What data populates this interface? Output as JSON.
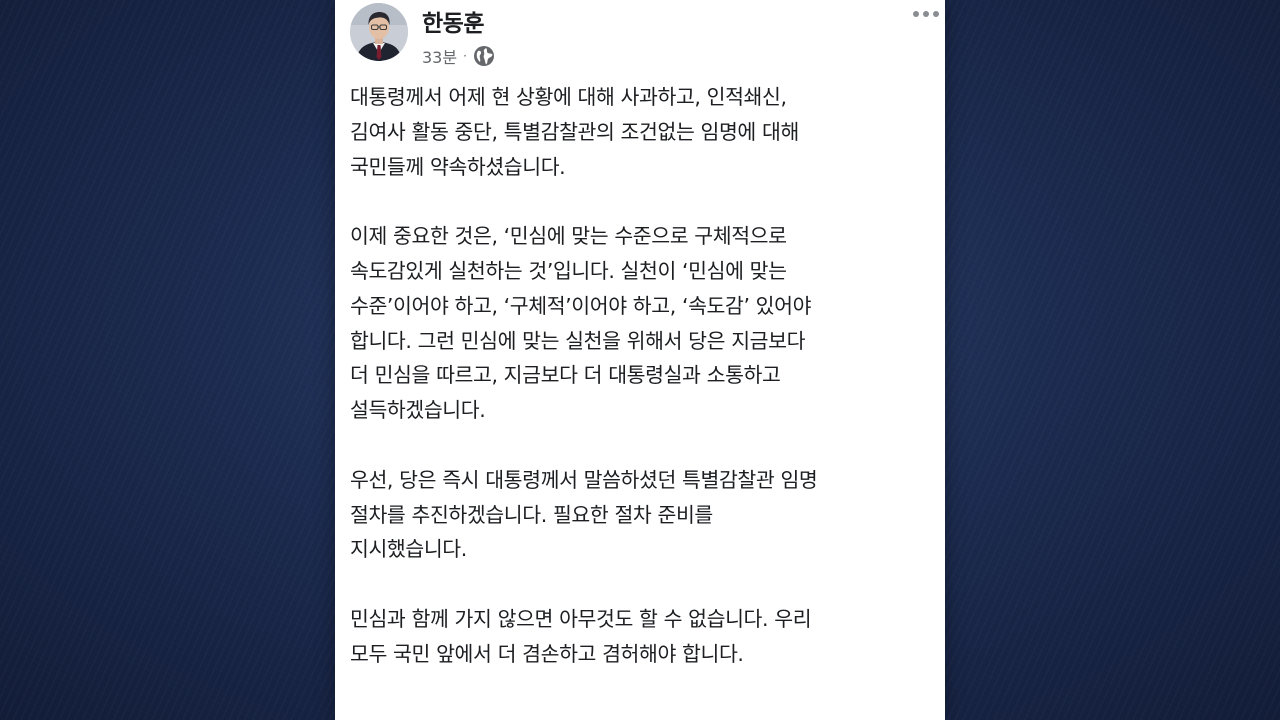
{
  "post": {
    "author": "한동훈",
    "time": "33분",
    "separator": "·",
    "privacy_icon": "globe-icon",
    "more_icon": "more-horizontal-icon",
    "paragraphs": [
      [
        "대통령께서 어제 현 상황에 대해 사과하고, 인적쇄신,",
        "김여사 활동 중단, 특별감찰관의 조건없는 임명에 대해",
        "국민들께 약속하셨습니다."
      ],
      [
        "이제 중요한 것은, ‘민심에 맞는 수준으로 구체적으로",
        "속도감있게  실천하는 것’입니다. 실천이 ‘민심에 맞는",
        "수준’이어야 하고, ‘구체적’이어야 하고, ‘속도감’ 있어야",
        "합니다. 그런 민심에 맞는 실천을 위해서 당은 지금보다",
        "더 민심을 따르고, 지금보다 더 대통령실과 소통하고",
        "설득하겠습니다."
      ],
      [
        "우선, 당은 즉시 대통령께서 말씀하셨던 특별감찰관 임명",
        "절차를 추진하겠습니다. 필요한 절차 준비를",
        "지시했습니다."
      ],
      [
        "민심과 함께 가지 않으면 아무것도 할 수 없습니다. 우리",
        "모두 국민 앞에서 더 겸손하고 겸허해야 합니다."
      ]
    ]
  },
  "colors": {
    "background": "#1c2b50",
    "card": "#ffffff",
    "text": "#1c1e21",
    "meta": "#65676b"
  }
}
